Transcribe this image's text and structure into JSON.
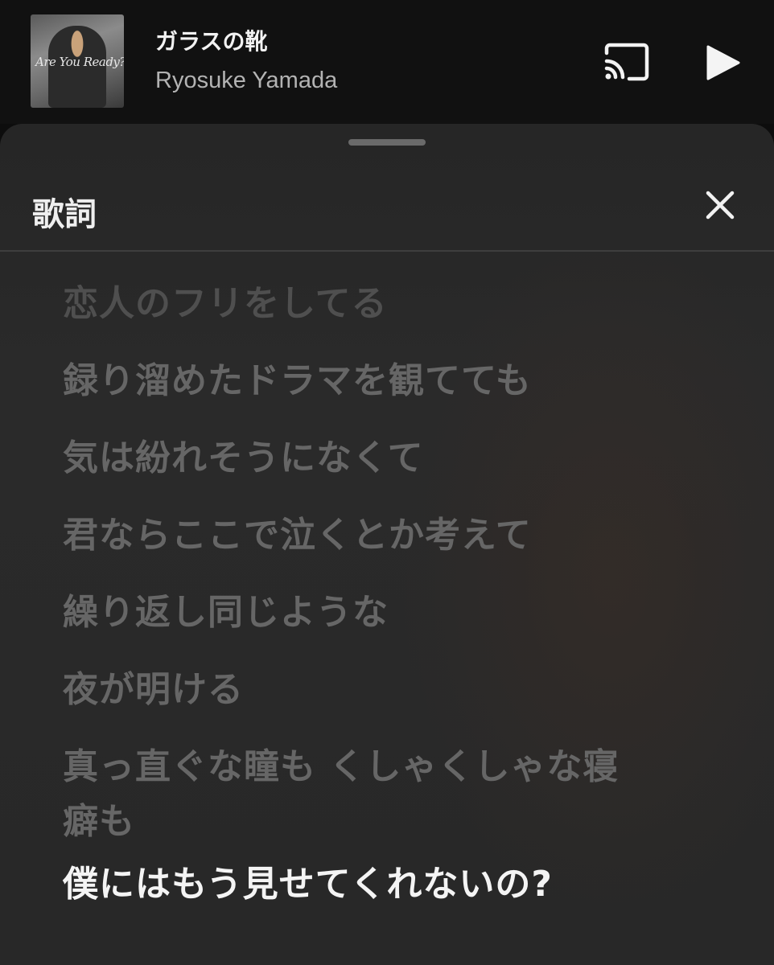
{
  "now_playing": {
    "title": "ガラスの靴",
    "artist": "Ryosuke Yamada",
    "album_art_text": "Are You Ready?"
  },
  "icons": {
    "cast": "cast-icon",
    "play": "play-icon",
    "close": "close-icon"
  },
  "lyrics_panel": {
    "title": "歌詞",
    "lines": [
      "恋人のフリをしてる",
      "録り溜めたドラマを観てても",
      "気は紛れそうになくて",
      "君ならここで泣くとか考えて",
      "繰り返し同じような",
      "夜が明ける",
      "真っ直ぐな瞳も くしゃくしゃな寝癖も",
      "僕にはもう見せてくれないの?"
    ]
  },
  "colors": {
    "background": "#111111",
    "sheet": "#282828",
    "lyric_inactive": "#666666",
    "lyric_active": "#f4f4f4"
  }
}
